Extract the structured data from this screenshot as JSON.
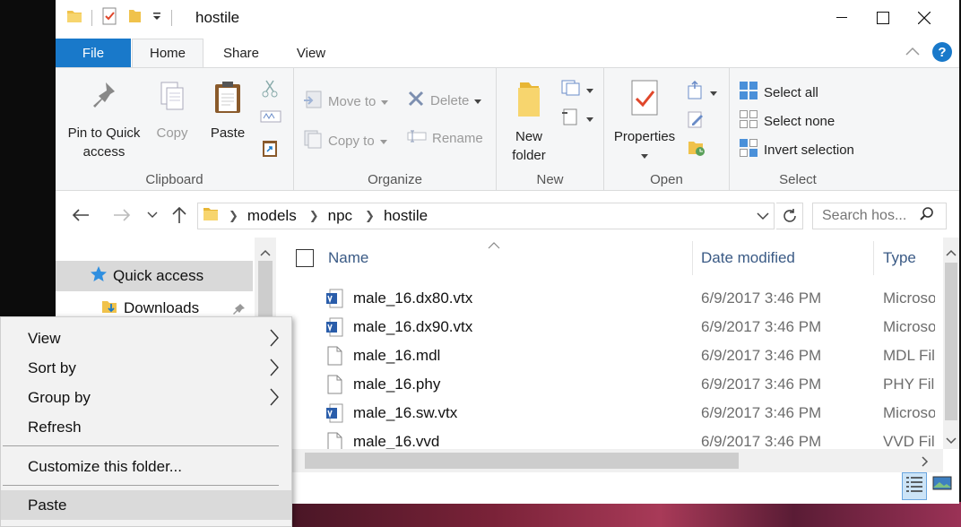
{
  "window": {
    "title": "hostile"
  },
  "ribbon_tabs": [
    "File",
    "Home",
    "Share",
    "View"
  ],
  "ribbon": {
    "clipboard": {
      "label": "Clipboard",
      "pin_label_1": "Pin to Quick",
      "pin_label_2": "access",
      "copy_label": "Copy",
      "paste_label": "Paste"
    },
    "organize": {
      "label": "Organize",
      "move_to": "Move to",
      "copy_to": "Copy to",
      "delete": "Delete",
      "rename": "Rename"
    },
    "new": {
      "label": "New",
      "new_folder_1": "New",
      "new_folder_2": "folder"
    },
    "open": {
      "label": "Open",
      "properties": "Properties"
    },
    "select": {
      "label": "Select",
      "select_all": "Select all",
      "select_none": "Select none",
      "invert": "Invert selection"
    }
  },
  "address": {
    "crumbs": [
      "models",
      "npc",
      "hostile"
    ],
    "search_placeholder": "Search hos..."
  },
  "navpane": {
    "items": [
      {
        "label": "Quick access"
      },
      {
        "label": "Downloads"
      }
    ]
  },
  "filelist": {
    "columns": [
      "Name",
      "Date modified",
      "Type"
    ],
    "rows": [
      {
        "name": "male_16.dx80.vtx",
        "date": "6/9/2017 3:46 PM",
        "type": "Microso",
        "icon": "vs-file-icon"
      },
      {
        "name": "male_16.dx90.vtx",
        "date": "6/9/2017 3:46 PM",
        "type": "Microso",
        "icon": "vs-file-icon"
      },
      {
        "name": "male_16.mdl",
        "date": "6/9/2017 3:46 PM",
        "type": "MDL Fil",
        "icon": "blank-file-icon"
      },
      {
        "name": "male_16.phy",
        "date": "6/9/2017 3:46 PM",
        "type": "PHY Fil",
        "icon": "blank-file-icon"
      },
      {
        "name": "male_16.sw.vtx",
        "date": "6/9/2017 3:46 PM",
        "type": "Microso",
        "icon": "vs-file-icon"
      },
      {
        "name": "male_16.vvd",
        "date": "6/9/2017 3:46 PM",
        "type": "VVD Fil",
        "icon": "blank-file-icon"
      }
    ]
  },
  "context_menu": {
    "items": [
      {
        "label": "View",
        "submenu": true
      },
      {
        "label": "Sort by",
        "submenu": true
      },
      {
        "label": "Group by",
        "submenu": true
      },
      {
        "label": "Refresh",
        "submenu": false
      },
      {
        "label": "Customize this folder...",
        "submenu": false
      },
      {
        "label": "Paste",
        "submenu": false
      }
    ]
  },
  "colors": {
    "accent": "#1979ca",
    "folder": "#f0c24b",
    "header_text": "#3a5a85"
  }
}
